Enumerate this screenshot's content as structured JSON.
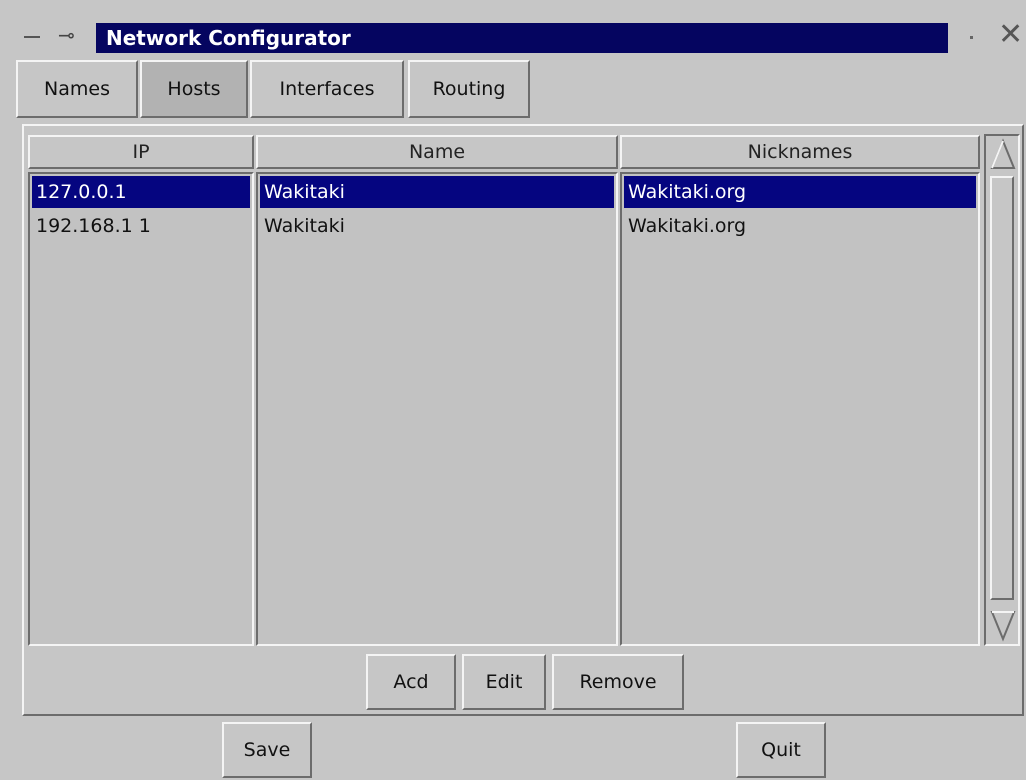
{
  "window": {
    "title": "Network Configurator",
    "pin_glyph": "⊸",
    "close_glyph": "✕"
  },
  "tabs": [
    {
      "label": "Names",
      "active": false
    },
    {
      "label": "Hosts",
      "active": true
    },
    {
      "label": "Interfaces",
      "active": false
    },
    {
      "label": "Routing",
      "active": false
    }
  ],
  "table": {
    "headers": {
      "ip": "IP",
      "name": "Name",
      "nicknames": "Nicknames"
    },
    "rows": [
      {
        "ip": "127.0.0.1",
        "name": "Wakitaki",
        "nicknames": "Wakitaki.org",
        "selected": true
      },
      {
        "ip": "192.168.1 1",
        "name": "Wakitaki",
        "nicknames": "Wakitaki.org",
        "selected": false
      }
    ]
  },
  "actions": {
    "add": "Acd",
    "edit": "Edit",
    "remove": "Remove"
  },
  "footer": {
    "save": "Save",
    "quit": "Quit"
  },
  "colors": {
    "selection": "#050580",
    "titlebar": "#050560",
    "face": "#c6c6c6"
  },
  "icons": {
    "scroll_up": "scroll-up-arrow-icon",
    "scroll_down": "scroll-down-arrow-icon"
  }
}
